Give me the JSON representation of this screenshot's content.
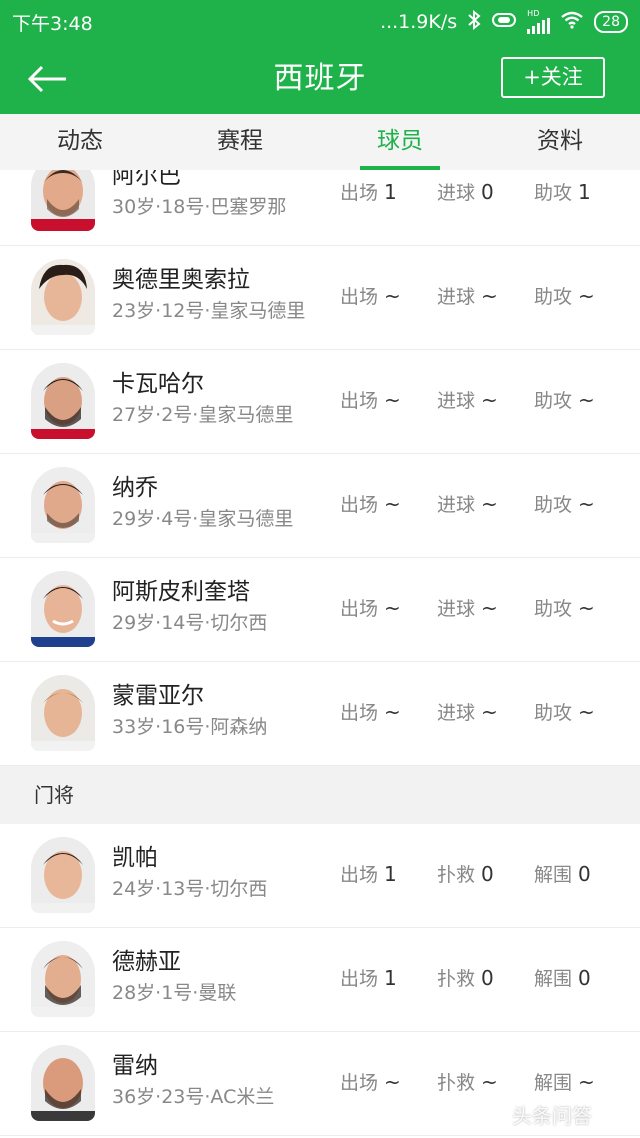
{
  "status_bar": {
    "time": "下午3:48",
    "speed": "...1.9K/s",
    "battery": "28",
    "network_label": "HD"
  },
  "header": {
    "title": "西班牙",
    "follow_label": "+关注"
  },
  "tabs": [
    "动态",
    "赛程",
    "球员",
    "资料"
  ],
  "active_tab": "球员",
  "stat_labels": {
    "apps": "出场",
    "goals": "进球",
    "assists": "助攻",
    "saves": "扑救",
    "clearances": "解围"
  },
  "players": [
    {
      "name": "阿尔巴",
      "meta": "30岁·18号·巴塞罗那",
      "stats": [
        "1",
        "0",
        "1"
      ]
    },
    {
      "name": "奥德里奥索拉",
      "meta": "23岁·12号·皇家马德里",
      "stats": [
        "~",
        "~",
        "~"
      ]
    },
    {
      "name": "卡瓦哈尔",
      "meta": "27岁·2号·皇家马德里",
      "stats": [
        "~",
        "~",
        "~"
      ]
    },
    {
      "name": "纳乔",
      "meta": "29岁·4号·皇家马德里",
      "stats": [
        "~",
        "~",
        "~"
      ]
    },
    {
      "name": "阿斯皮利奎塔",
      "meta": "29岁·14号·切尔西",
      "stats": [
        "~",
        "~",
        "~"
      ]
    },
    {
      "name": "蒙雷亚尔",
      "meta": "33岁·16号·阿森纳",
      "stats": [
        "~",
        "~",
        "~"
      ]
    }
  ],
  "goalkeeper_section": "门将",
  "goalkeepers": [
    {
      "name": "凯帕",
      "meta": "24岁·13号·切尔西",
      "stats": [
        "1",
        "0",
        "0"
      ]
    },
    {
      "name": "德赫亚",
      "meta": "28岁·1号·曼联",
      "stats": [
        "1",
        "0",
        "0"
      ]
    },
    {
      "name": "雷纳",
      "meta": "36岁·23号·AC米兰",
      "stats": [
        "~",
        "~",
        "~"
      ]
    }
  ],
  "watermark": "头条问答",
  "colors": {
    "primary": "#1fb14a",
    "section_bg": "#f2f2f2"
  },
  "icons": {
    "back": "arrow-left-icon",
    "bluetooth": "bluetooth-icon",
    "wifi": "wifi-icon",
    "signal": "signal-icon",
    "battery": "battery-icon"
  }
}
